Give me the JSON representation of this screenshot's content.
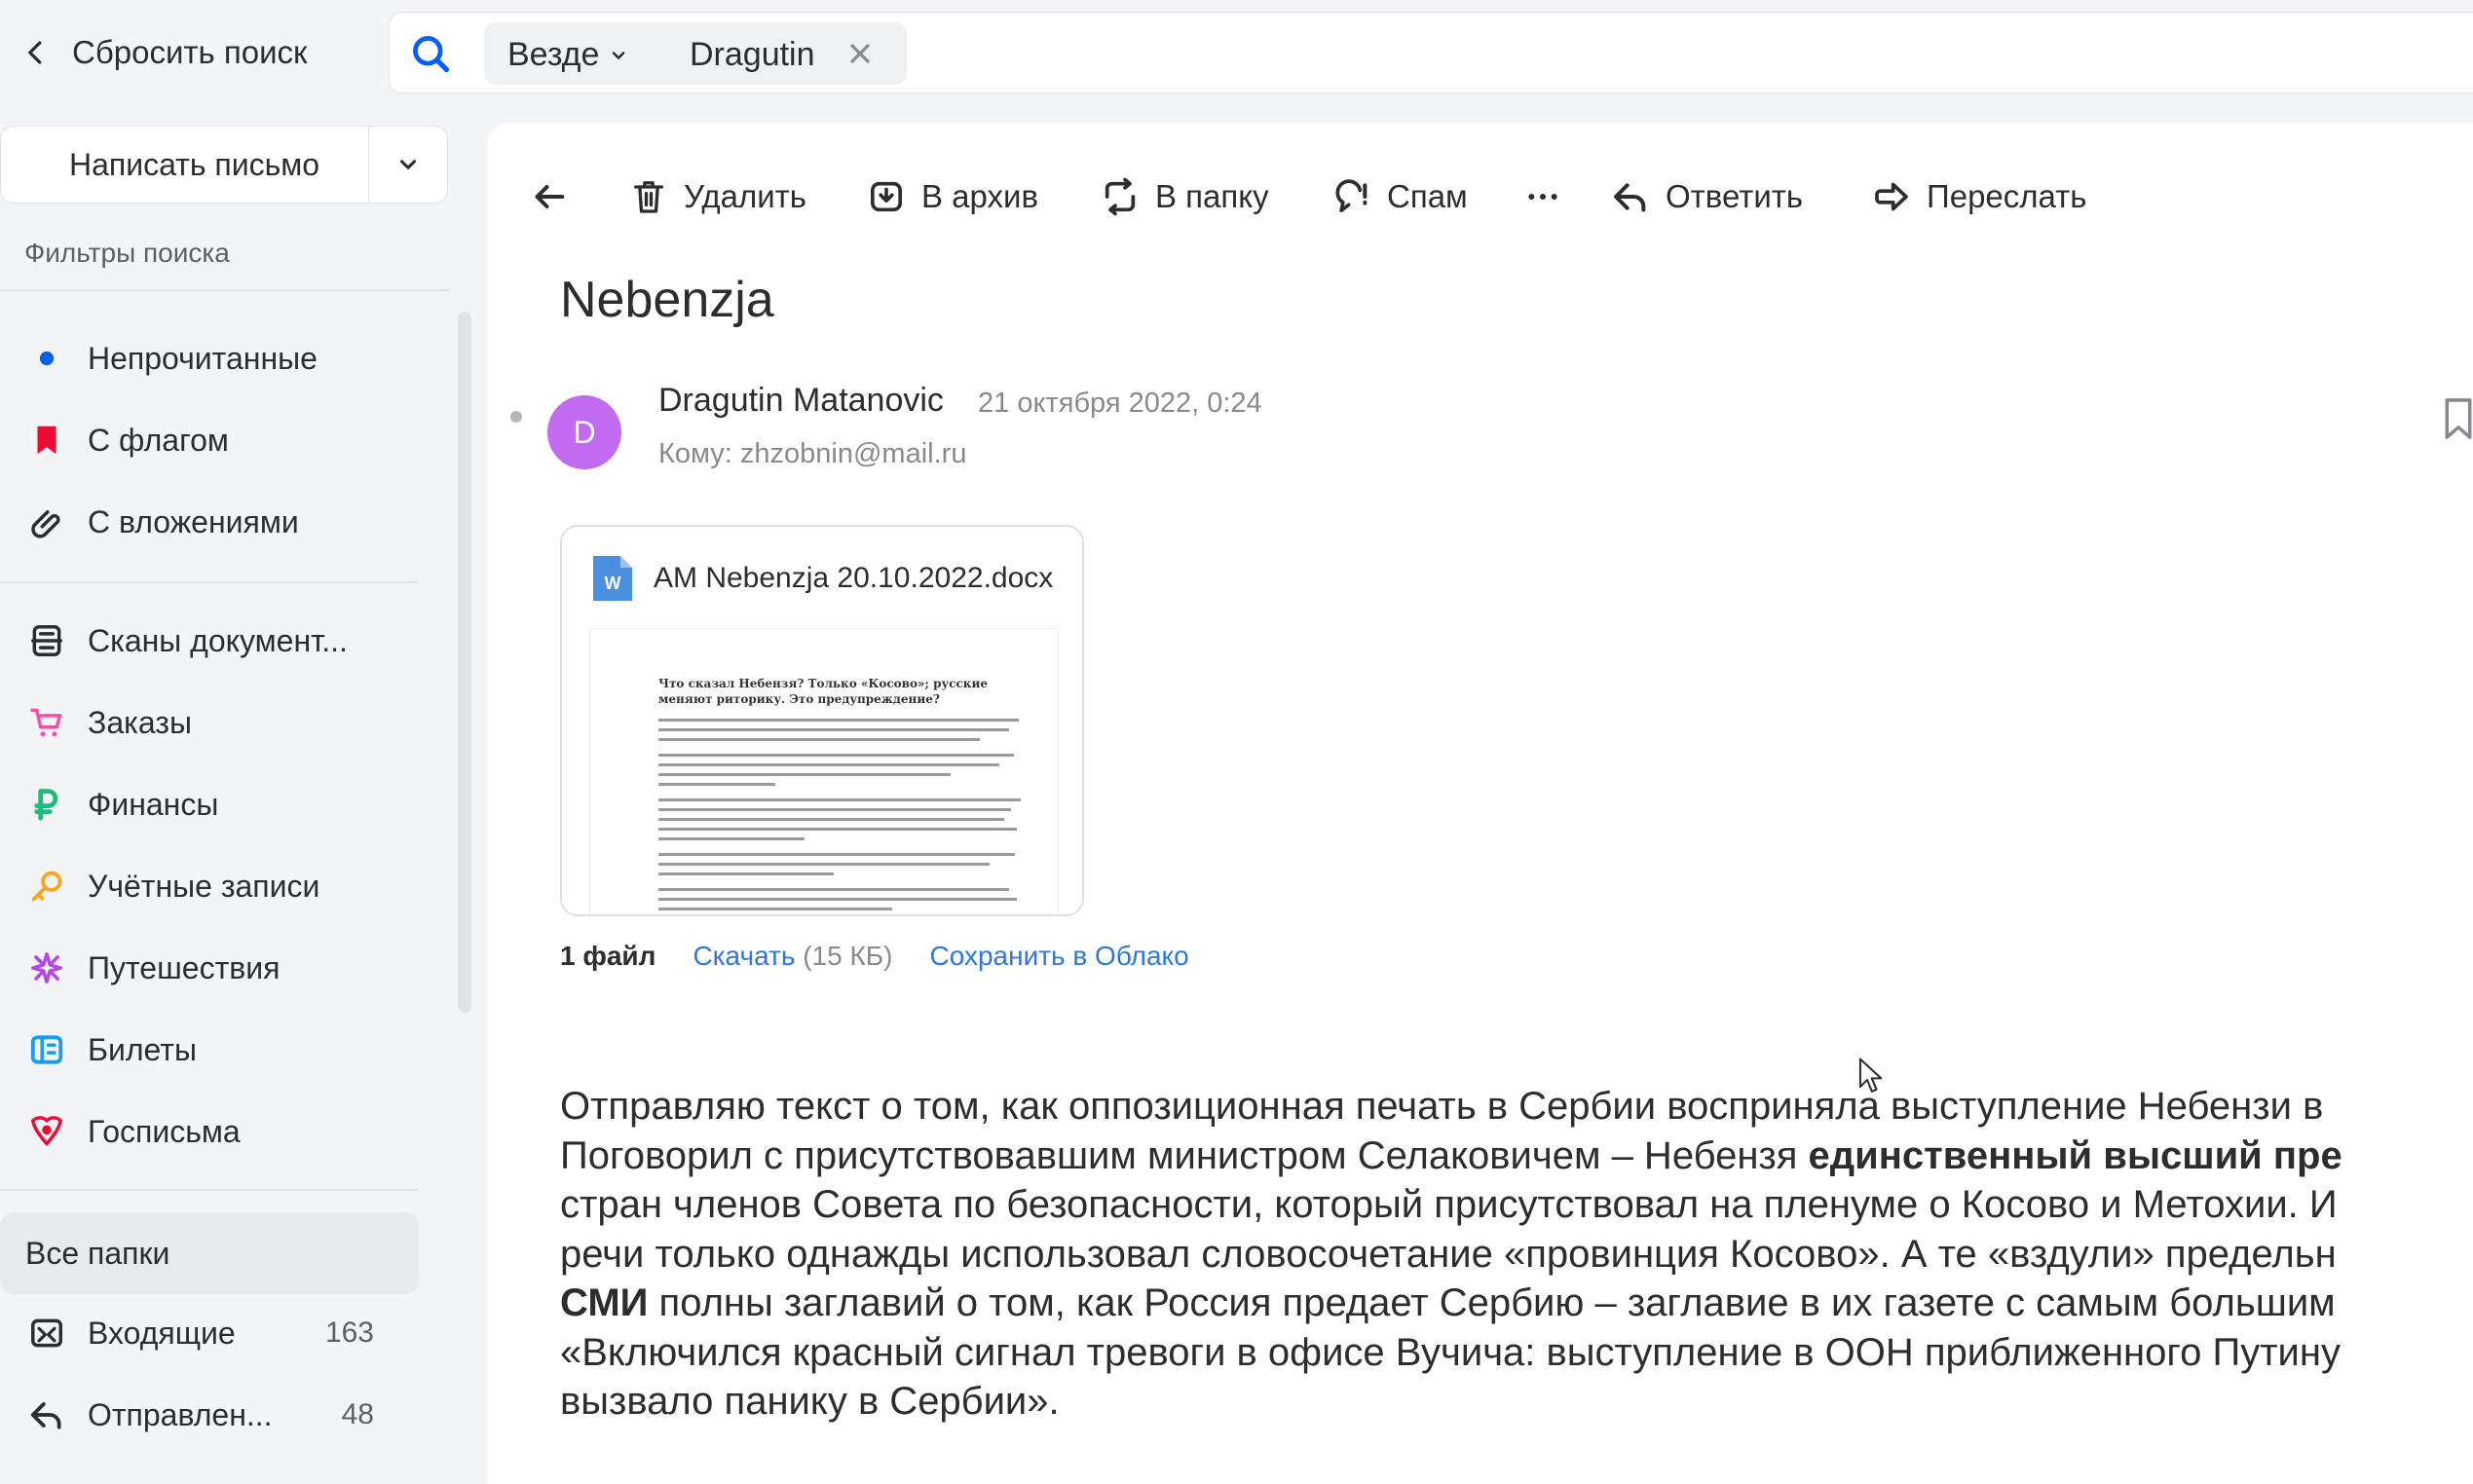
{
  "topbar": {
    "reset_label": "Сбросить поиск",
    "scope_label": "Везде",
    "query": "Dragutin"
  },
  "sidebar": {
    "compose_label": "Написать письмо",
    "filters_title": "Фильтры поиска",
    "filters": [
      {
        "label": "Непрочитанные",
        "icon": "unread-dot-icon",
        "color": "#005ff9"
      },
      {
        "label": "С флагом",
        "icon": "flag-icon",
        "color": "#ed0a34"
      },
      {
        "label": "С вложениями",
        "icon": "paperclip-icon",
        "color": "#2c2d2e"
      }
    ],
    "categories": [
      {
        "label": "Сканы документ...",
        "icon": "scanner-icon",
        "color": "#2c2d2e"
      },
      {
        "label": "Заказы",
        "icon": "cart-icon",
        "color": "#ff4da6"
      },
      {
        "label": "Финансы",
        "icon": "ruble-icon",
        "color": "#1cbc7a"
      },
      {
        "label": "Учётные записи",
        "icon": "key-icon",
        "color": "#ffa31a"
      },
      {
        "label": "Путешествия",
        "icon": "plane-icon",
        "color": "#b048e8"
      },
      {
        "label": "Билеты",
        "icon": "ticket-icon",
        "color": "#1a9bf0"
      },
      {
        "label": "Госписьма",
        "icon": "eagle-icon",
        "color": "#ed0a34"
      }
    ],
    "all_folders_label": "Все папки",
    "folders": [
      {
        "label": "Входящие",
        "count": "163",
        "icon": "inbox-icon"
      },
      {
        "label": "Отправлен...",
        "count": "48",
        "icon": "sent-icon"
      }
    ]
  },
  "toolbar": {
    "back_icon": "arrow-left-icon",
    "delete_label": "Удалить",
    "archive_label": "В архив",
    "move_label": "В папку",
    "spam_label": "Спам",
    "reply_label": "Ответить",
    "forward_label": "Переслать"
  },
  "message": {
    "subject": "Nebenzja",
    "avatar_letter": "D",
    "avatar_color": "#c26bf0",
    "sender": "Dragutin Matanovic",
    "date": "21 октября 2022, 0:24",
    "to_prefix": "Кому:",
    "to_address": "zhzobnin@mail.ru",
    "attachment": {
      "file_name": "AM Nebenzja 20.10.2022.docx",
      "preview_title": "Что сказал Небензя? Только «Косово»; русские меняют риторику. Это предупреждение?"
    },
    "files_count": "1 файл",
    "download_label": "Скачать",
    "download_size": "(15 КБ)",
    "save_cloud_label": "Сохранить в Облако",
    "body": {
      "l1": "Отправляю текст о том, как оппозиционная печать в Сербии восприняла выступление Небензи в",
      "l2a": "Поговорил с присутствовавшим министром Селаковичем – Небензя ",
      "l2b": "единственный высший пре",
      "l3": "стран членов Совета по безопасности, который присутствовал на пленуме о Косово и Метохии. И",
      "l4": "речи только однажды использовал словосочетание «провинция Косово». А те «вздули» предельн",
      "l5a": "СМИ",
      "l5b": " полны заглавий о том, как Россия предает Сербию – заглавие в их газете с самым большим",
      "l6": "«Включился красный сигнал тревоги в офисе Вучича: выступление в ООН приближенного Путину",
      "l7": "вызвало панику в Сербии»."
    }
  }
}
